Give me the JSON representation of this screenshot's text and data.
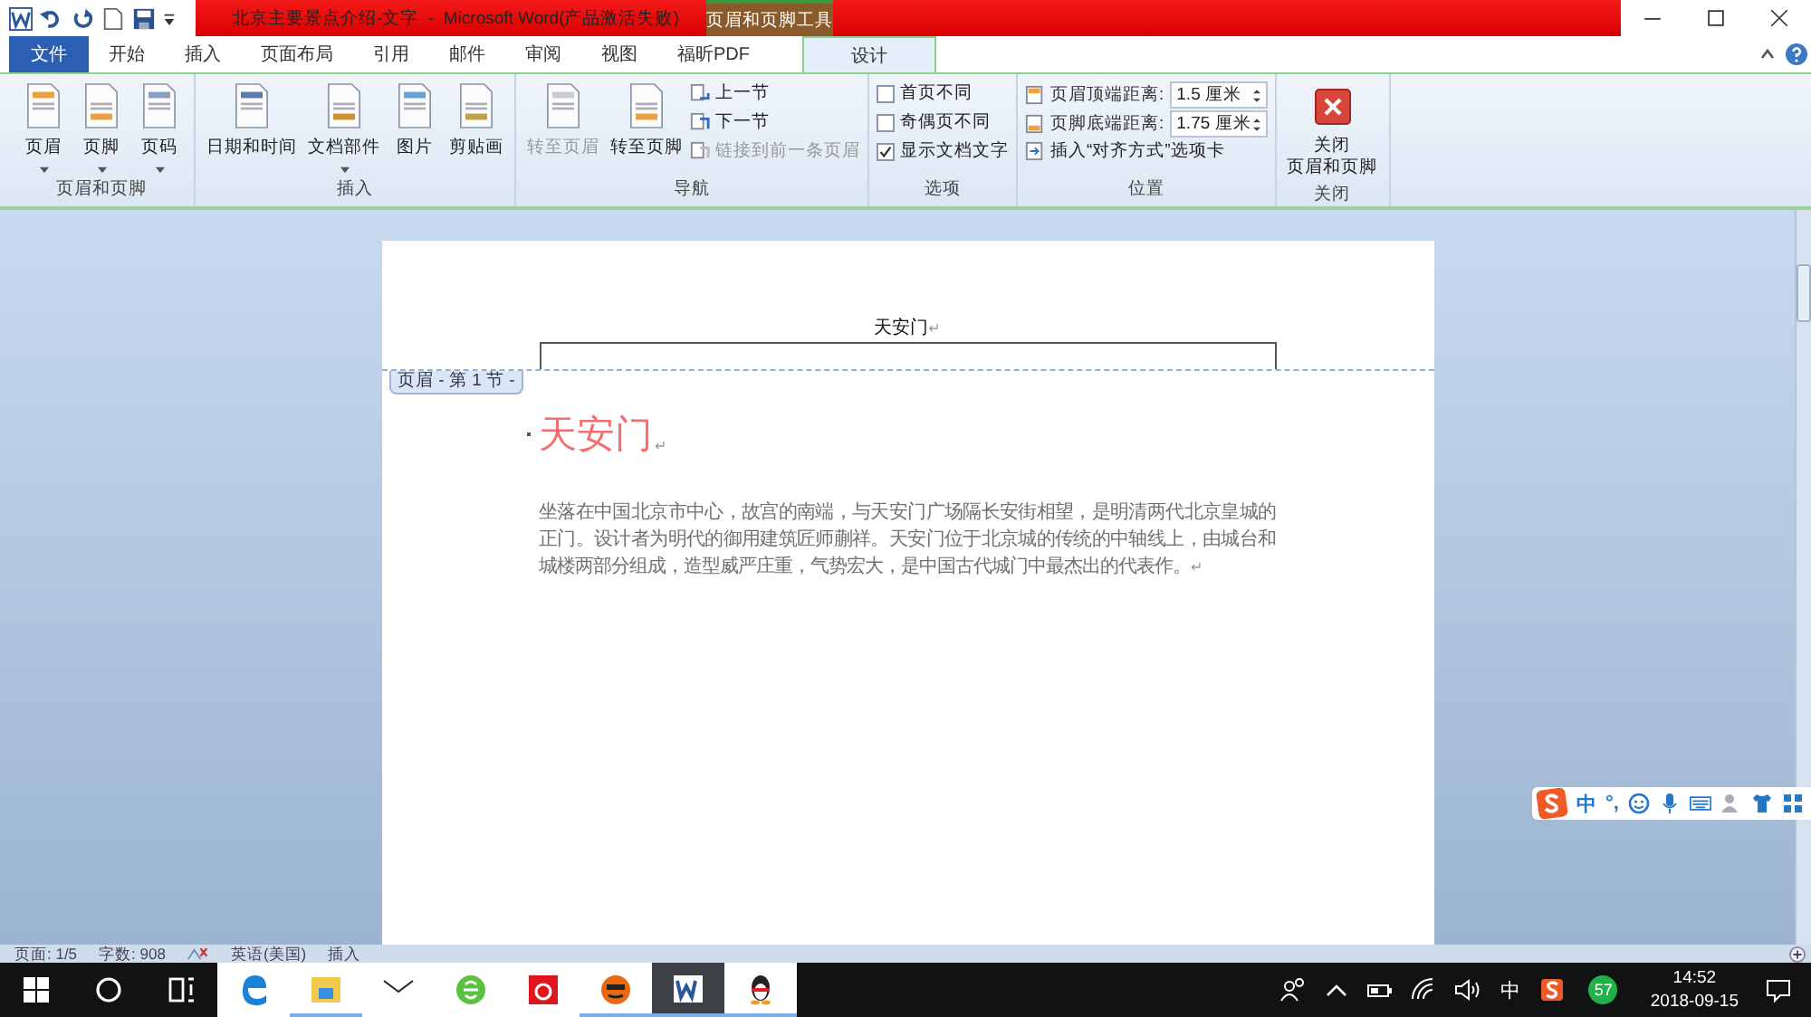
{
  "title_bar": {
    "title": "北京主要景点介绍-文字  -  Microsoft Word(产品激活失败)",
    "context_group": "页眉和页脚工具"
  },
  "tabs": [
    {
      "label": "文件",
      "kind": "file",
      "selected": false
    },
    {
      "label": "开始",
      "kind": "tab",
      "selected": false
    },
    {
      "label": "插入",
      "kind": "tab",
      "selected": false
    },
    {
      "label": "页面布局",
      "kind": "tab",
      "selected": false
    },
    {
      "label": "引用",
      "kind": "tab",
      "selected": false
    },
    {
      "label": "邮件",
      "kind": "tab",
      "selected": false
    },
    {
      "label": "审阅",
      "kind": "tab",
      "selected": false
    },
    {
      "label": "视图",
      "kind": "tab",
      "selected": false
    },
    {
      "label": "福昕PDF",
      "kind": "tab",
      "selected": false
    },
    {
      "label": "设计",
      "kind": "tab",
      "selected": true
    }
  ],
  "ribbon": [
    {
      "name": "页眉和页脚",
      "items": [
        {
          "kind": "big",
          "label": "页眉",
          "dropdown": true,
          "disabled": false
        },
        {
          "kind": "big",
          "label": "页脚",
          "dropdown": true,
          "disabled": false
        },
        {
          "kind": "big",
          "label": "页码",
          "dropdown": true,
          "disabled": false
        }
      ]
    },
    {
      "name": "插入",
      "items": [
        {
          "kind": "big",
          "label": "日期和时间",
          "dropdown": false,
          "disabled": false
        },
        {
          "kind": "big",
          "label": "文档部件",
          "dropdown": true,
          "disabled": false
        },
        {
          "kind": "big",
          "label": "图片",
          "dropdown": false,
          "disabled": false
        },
        {
          "kind": "big",
          "label": "剪贴画",
          "dropdown": false,
          "disabled": false
        }
      ]
    },
    {
      "name": "导航",
      "items": [
        {
          "kind": "big",
          "label": "转至页眉",
          "dropdown": false,
          "disabled": true
        },
        {
          "kind": "big",
          "label": "转至页脚",
          "dropdown": false,
          "disabled": false
        },
        {
          "kind": "stack",
          "rows": [
            {
              "label": "上一节",
              "disabled": false
            },
            {
              "label": "下一节",
              "disabled": false
            },
            {
              "label": "链接到前一条页眉",
              "disabled": true
            }
          ]
        }
      ]
    },
    {
      "name": "选项",
      "items": [
        {
          "kind": "checks",
          "rows": [
            {
              "label": "首页不同",
              "checked": false
            },
            {
              "label": "奇偶页不同",
              "checked": false
            },
            {
              "label": "显示文档文字",
              "checked": true
            }
          ]
        }
      ]
    },
    {
      "name": "位置",
      "items": [
        {
          "kind": "position",
          "rows": [
            {
              "label": "页眉顶端距离:",
              "value": "1.5 厘米"
            },
            {
              "label": "页脚底端距离:",
              "value": "1.75 厘米"
            }
          ],
          "link": "插入“对齐方式”选项卡"
        }
      ]
    },
    {
      "name": "关闭",
      "items": [
        {
          "kind": "close",
          "lines": [
            "关闭",
            "页眉和页脚"
          ]
        }
      ]
    }
  ],
  "document": {
    "header_text": "天安门",
    "header_mark": "↵",
    "heading_mark": "↵",
    "paragraph_mark": "↵",
    "header_tag": "页眉 - 第 1 节 -",
    "heading": "天安门",
    "paragraph": "坐落在中国北京市中心，故宫的南端，与天安门广场隔长安街相望，是明清两代北京皇城的正门。设计者为明代的御用建筑匠师蒯祥。天安门位于北京城的传统的中轴线上，由城台和城楼两部分组成，造型威严庄重，气势宏大，是中国古代城门中最杰出的代表作。"
  },
  "status_bar": [
    {
      "kind": "text",
      "text": "页面: 1/5"
    },
    {
      "kind": "text",
      "text": "字数: 908"
    },
    {
      "kind": "icon"
    },
    {
      "kind": "text",
      "text": "英语(美国)"
    },
    {
      "kind": "text",
      "text": "插入"
    }
  ],
  "ime_bar": {
    "mode": "中",
    "punct": "°,"
  },
  "taskbar": {
    "ime": "中",
    "badge": "57",
    "time": "14:52",
    "date": "2018-09-15"
  }
}
